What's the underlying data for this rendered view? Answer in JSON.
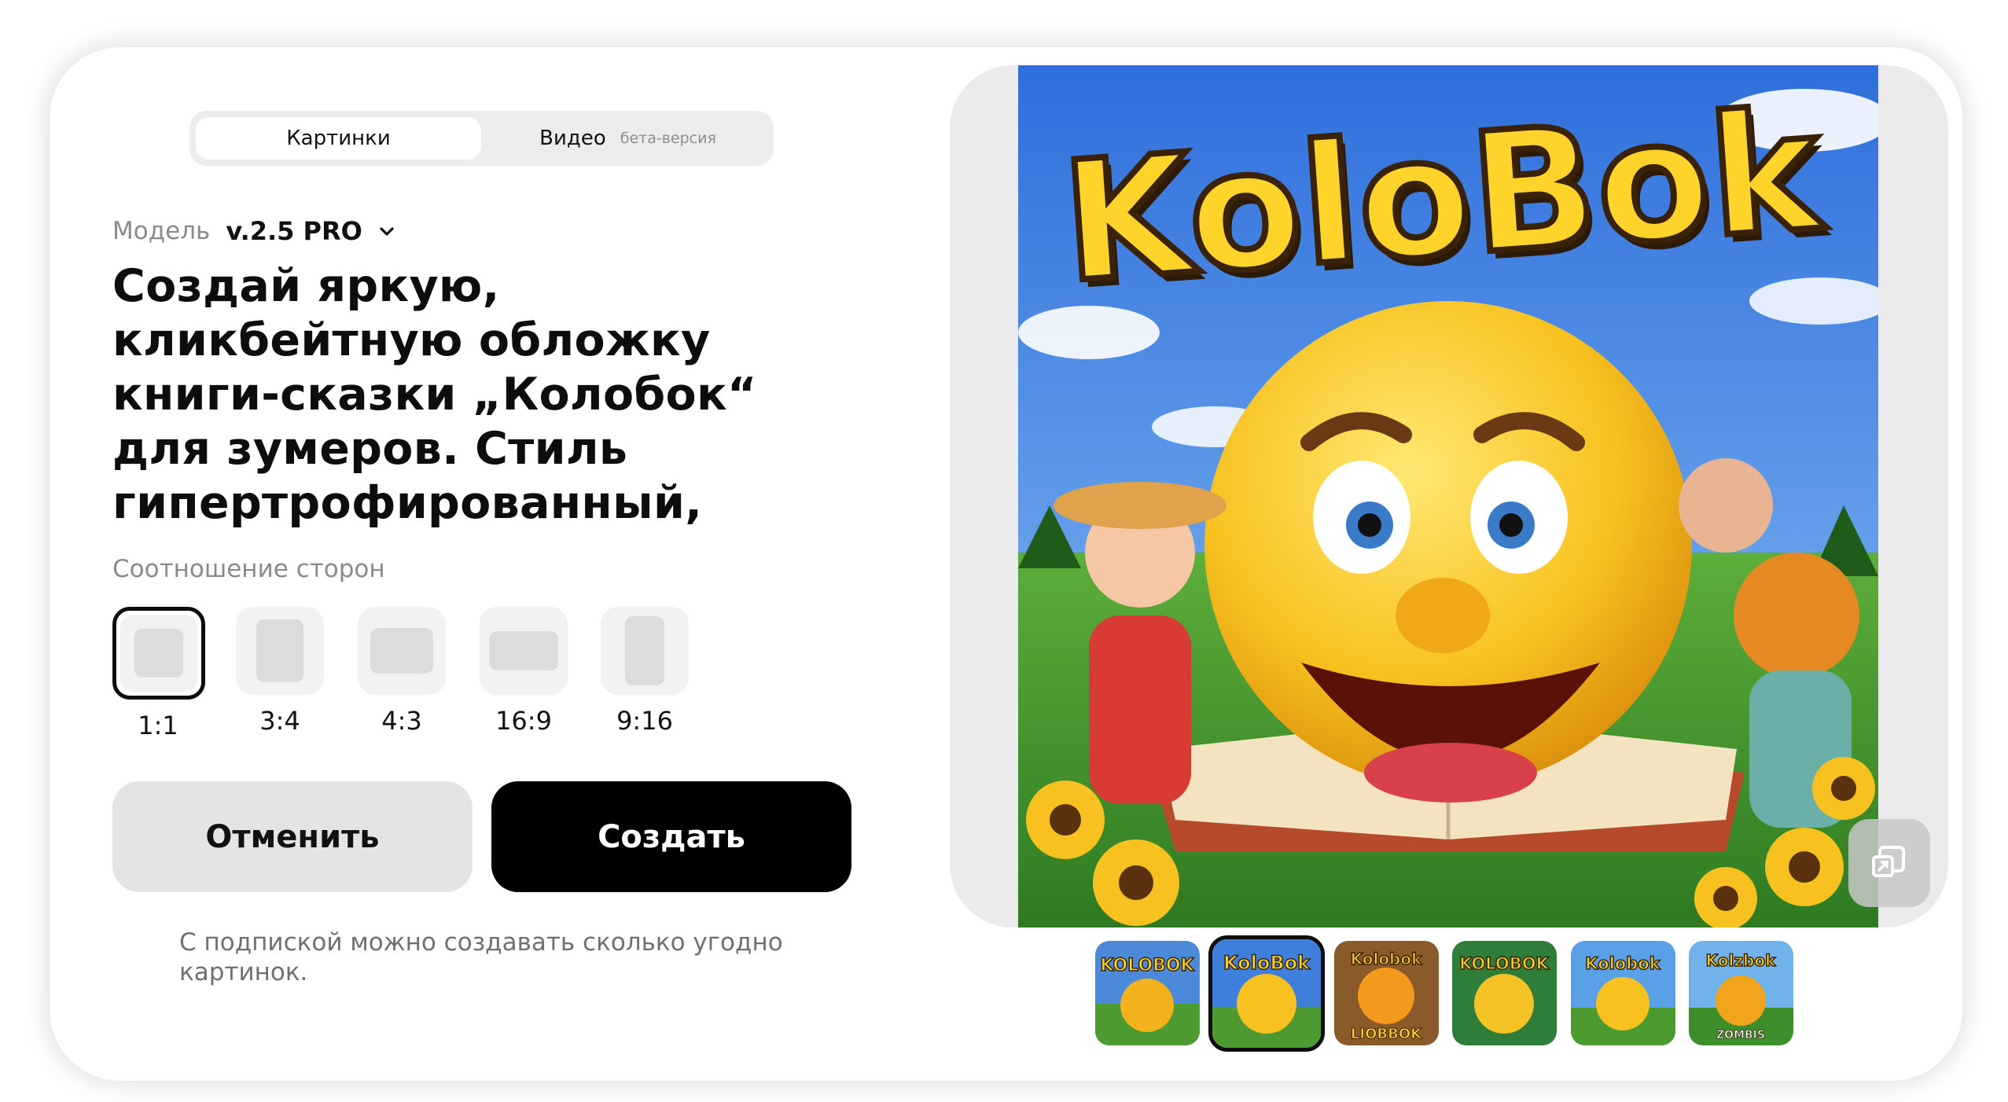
{
  "tabs": {
    "images_label": "Картинки",
    "video_label": "Видео",
    "video_badge": "бета-версия"
  },
  "model": {
    "label": "Модель",
    "value": "v.2.5 PRO"
  },
  "prompt": "Создай яркую, кликбейтную обложку книги-сказки „Колобок“ для зумеров. Стиль гипертрофированный, мультяшный",
  "aspect": {
    "title": "Соотношение сторон",
    "options": [
      {
        "label": "1:1",
        "selected": true
      },
      {
        "label": "3:4",
        "selected": false
      },
      {
        "label": "4:3",
        "selected": false
      },
      {
        "label": "16:9",
        "selected": false
      },
      {
        "label": "9:16",
        "selected": false
      }
    ]
  },
  "buttons": {
    "cancel": "Отменить",
    "create": "Создать"
  },
  "note": "С подпиской можно создавать сколько угодно картинок.",
  "preview": {
    "title_text": "KoloBok",
    "selected_index": 1
  },
  "thumbnails": [
    {
      "title": "KOLOBOK",
      "selected": false
    },
    {
      "title": "KoloBok",
      "selected": true
    },
    {
      "title": "Kolobok",
      "selected": false,
      "subtitle": "LIOBBOK"
    },
    {
      "title": "KOLOBOK",
      "selected": false
    },
    {
      "title": "Kolobok",
      "selected": false
    },
    {
      "title": "Kolzbok",
      "selected": false,
      "subtitle": "ZOMBIS"
    }
  ],
  "colors": {
    "accent": "#000000",
    "muted_text": "#8a8a8a",
    "button_gray": "#e4e4e4",
    "tab_bg": "#ececec"
  }
}
